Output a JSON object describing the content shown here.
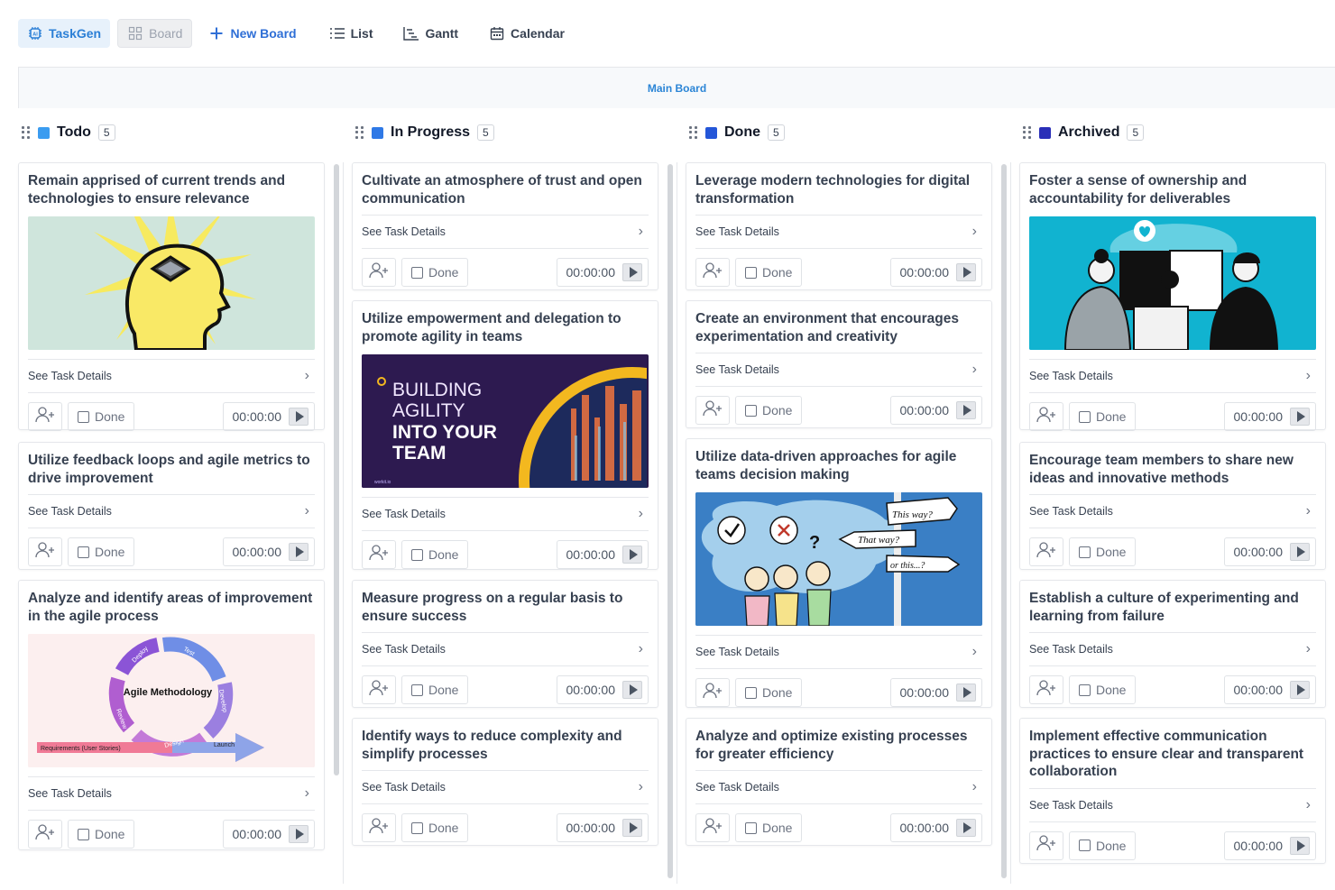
{
  "nav": {
    "brand": "TaskGen",
    "board": "Board",
    "new_board": "New Board",
    "list": "List",
    "gantt": "Gantt",
    "calendar": "Calendar"
  },
  "board_title": "Main Board",
  "common": {
    "see_details": "See Task Details",
    "done": "Done",
    "timer": "00:00:00"
  },
  "colors": {
    "todo": "#3b9cf0",
    "in_progress": "#2f79e6",
    "done": "#2456d8",
    "archived": "#2a2fb8"
  },
  "columns": [
    {
      "title": "Todo",
      "count": "5",
      "cards": [
        {
          "title": "Remain apprised of current trends and technologies to ensure relevance",
          "image": "head-chip-illustration"
        },
        {
          "title": "Utilize feedback loops and agile metrics to drive improvement"
        },
        {
          "title": "Analyze and identify areas of improvement in the agile process",
          "image": "agile-methodology-diagram",
          "image_text": {
            "center": "Agile Methodology",
            "labels": [
              "Deploy",
              "Test",
              "Develop",
              "Design",
              "Review",
              "Launch",
              "Requirements (User Stories)"
            ]
          }
        }
      ]
    },
    {
      "title": "In Progress",
      "count": "5",
      "cards": [
        {
          "title": "Cultivate an atmosphere of trust and open communication"
        },
        {
          "title": "Utilize empowerment and delegation to promote agility in teams",
          "image": "building-agility-banner",
          "image_text": {
            "line1": "BUILDING",
            "line2": "AGILITY",
            "line3": "INTO YOUR",
            "line4": "TEAM",
            "small": "workit.io"
          }
        },
        {
          "title": "Measure progress on a regular basis to ensure success"
        },
        {
          "title": "Identify ways to reduce complexity and simplify processes"
        }
      ]
    },
    {
      "title": "Done",
      "count": "5",
      "cards": [
        {
          "title": "Leverage modern technologies for digital transformation"
        },
        {
          "title": "Create an environment that encourages experimentation and creativity"
        },
        {
          "title": "Utilize data-driven approaches for agile teams decision making",
          "image": "signpost-illustration",
          "image_text": {
            "sign1": "This way?",
            "sign2": "That way?",
            "sign3": "or this...?"
          }
        },
        {
          "title": "Analyze and optimize existing processes for greater efficiency"
        }
      ]
    },
    {
      "title": "Archived",
      "count": "5",
      "cards": [
        {
          "title": "Foster a sense of ownership and accountability for deliverables",
          "image": "puzzle-team-illustration"
        },
        {
          "title": "Encourage team members to share new ideas and innovative methods"
        },
        {
          "title": "Establish a culture of experimenting and learning from failure"
        },
        {
          "title": "Implement effective communication practices to ensure clear and transparent collaboration"
        }
      ]
    }
  ]
}
